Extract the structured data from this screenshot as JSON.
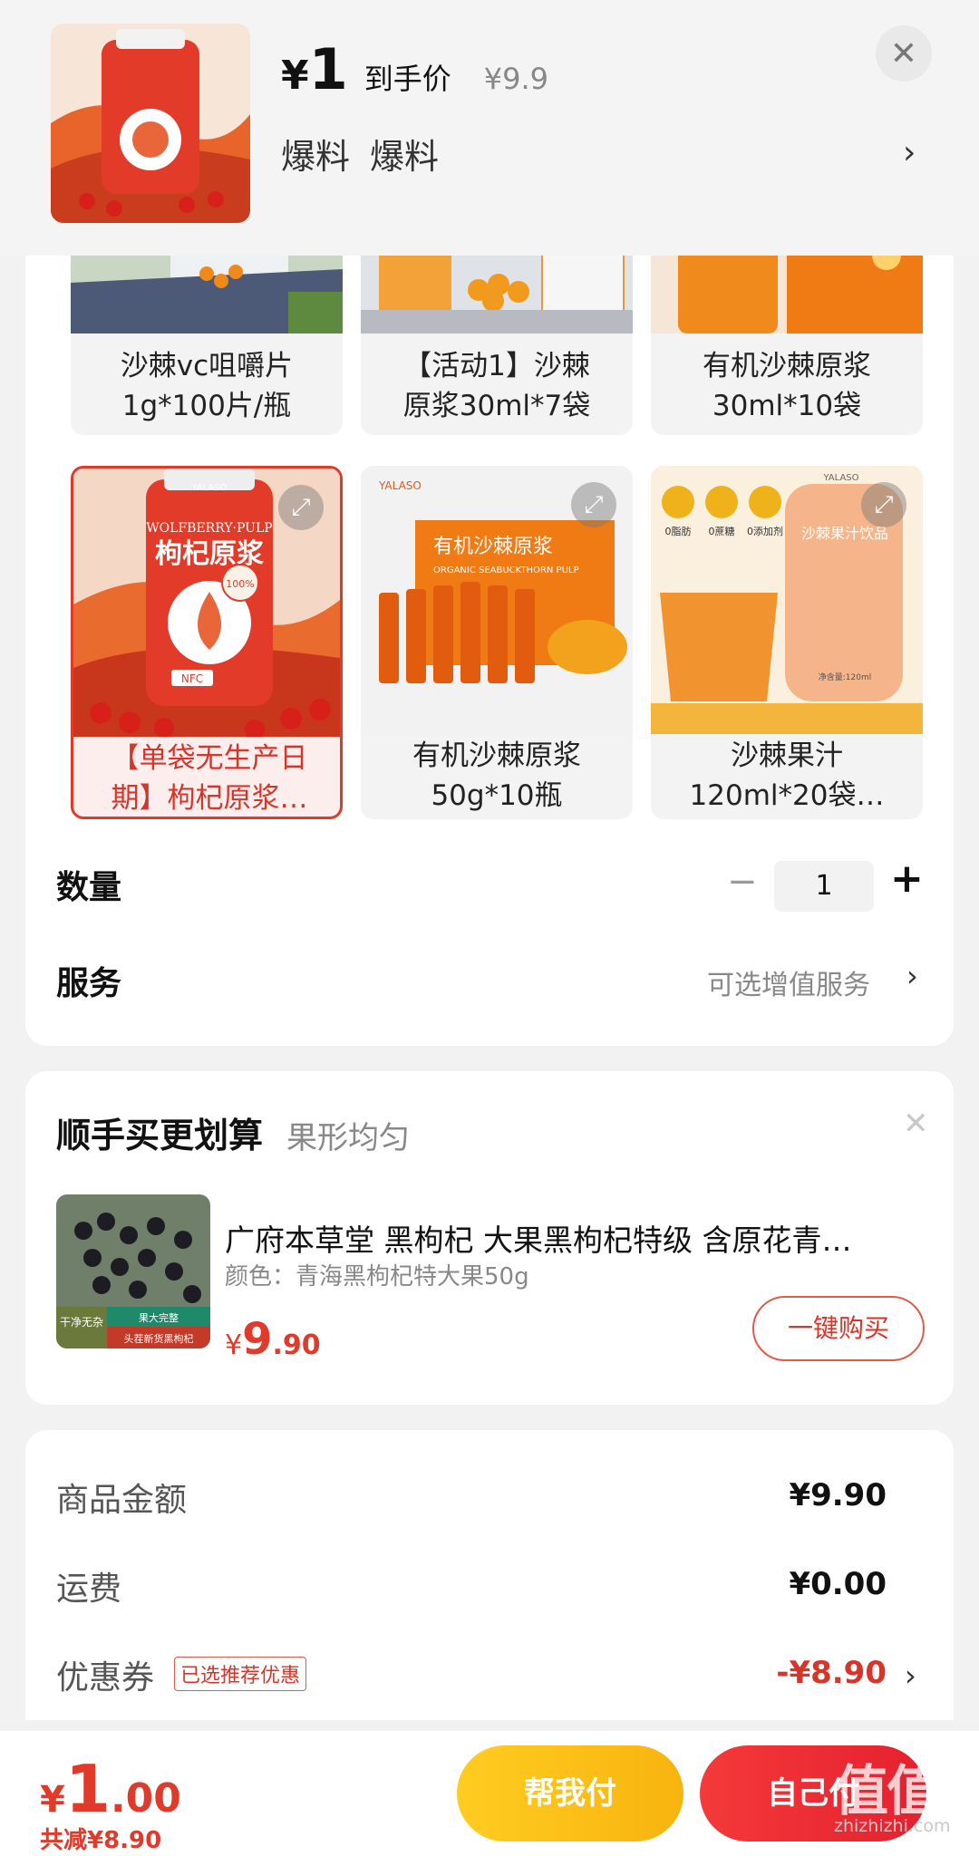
{
  "header": {
    "currency": "¥",
    "price": "1",
    "price_label": "到手价",
    "original_price": "¥9.9",
    "tags": [
      "爆料",
      "爆料"
    ]
  },
  "variants": [
    {
      "caption": "沙棘vc咀嚼片\n1g*100片/瓶",
      "selected": false
    },
    {
      "caption": "【活动1】沙棘\n原浆30ml*7袋",
      "selected": false
    },
    {
      "caption": "有机沙棘原浆\n30ml*10袋",
      "selected": false
    },
    {
      "caption": "【单袋无生产日\n期】枸杞原浆…",
      "selected": true,
      "img_text_en": "WOLFBERRY·PULP",
      "img_text_cn": "枸杞原浆",
      "img_badge": "100%",
      "img_tag": "NFC",
      "img_brand": "YALASO"
    },
    {
      "caption": "有机沙棘原浆\n50g*10瓶",
      "selected": false,
      "img_brand": "YALASO",
      "img_title": "有机沙棘原浆",
      "img_sub": "ORGANIC SEABUCKTHORN PULP"
    },
    {
      "caption": "沙棘果汁\n120ml*20袋…",
      "selected": false,
      "img_brand": "YALASO",
      "img_badges": [
        "0脂肪",
        "0蔗糖",
        "0添加剂"
      ],
      "img_pouch": "沙棘果汁饮品",
      "img_net": "净含量:120ml"
    }
  ],
  "quantity": {
    "label": "数量",
    "value": "1",
    "minus": "−",
    "plus": "+"
  },
  "service": {
    "label": "服务",
    "value": "可选增值服务"
  },
  "upsell": {
    "title": "顺手买更划算",
    "subtitle": "果形均匀",
    "product_name": "广府本草堂 黑枸杞 大果黑枸杞特级 含原花青…",
    "spec": "颜色：青海黑枸杞特大果50g",
    "price_currency": "¥",
    "price_int": "9",
    "price_dec": ".90",
    "buy_button": "一键购买",
    "thumb_text1": "干净无杂",
    "thumb_text2": "果大完整",
    "thumb_text3": "头茬新货黑枸杞"
  },
  "summary": {
    "rows": [
      {
        "label": "商品金额",
        "value": "¥9.90"
      },
      {
        "label": "运费",
        "value": "¥0.00"
      },
      {
        "label": "优惠券",
        "value": "-¥8.90",
        "badge": "已选推荐优惠"
      }
    ]
  },
  "bottom": {
    "currency": "¥",
    "total_int": "1",
    "total_dec": ".00",
    "saved": "共减¥8.90",
    "help_pay": "帮我付",
    "self_pay": "自己付",
    "watermark_domain": "zhizhizhi.com"
  },
  "colors": {
    "accent_red": "#e03a2a",
    "help_yellow": "#f8b40e",
    "pay_red": "#e5202f"
  }
}
